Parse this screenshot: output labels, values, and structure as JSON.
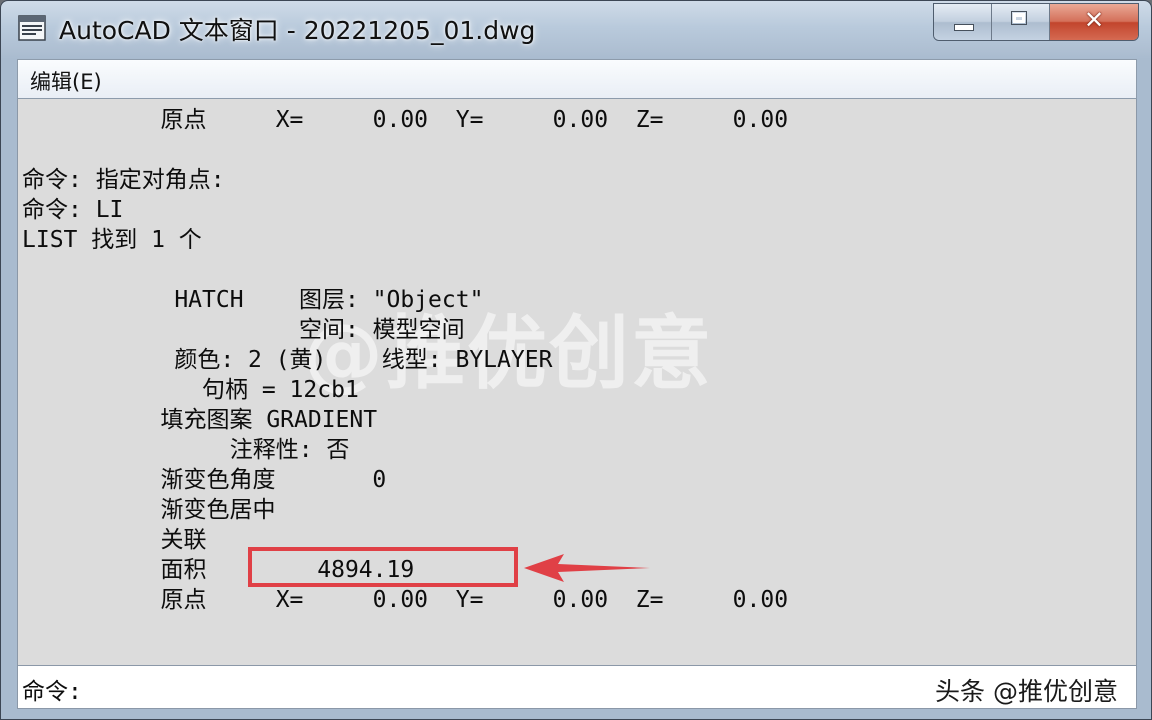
{
  "window": {
    "title": "AutoCAD 文本窗口 - 20221205_01.dwg",
    "icon": "autocad-text-window-icon",
    "controls": {
      "minimize": "minimize-icon",
      "maximize": "maximize-icon",
      "close": "close-icon"
    }
  },
  "menu": {
    "edit": "编辑(E)"
  },
  "text_window": {
    "lines": [
      "          原点     X=     0.00  Y=     0.00  Z=     0.00",
      "",
      "命令: 指定对角点:",
      "命令: LI",
      "LIST 找到 1 个",
      "",
      "           HATCH    图层: \"Object\"",
      "                    空间: 模型空间",
      "           颜色: 2 (黄)    线型: BYLAYER",
      "             句柄 = 12cb1",
      "          填充图案 GRADIENT",
      "               注释性: 否",
      "          渐变色角度       0",
      "          渐变色居中",
      "          关联",
      "          面积        4894.19",
      "          原点     X=     0.00  Y=     0.00  Z=     0.00"
    ],
    "watermark": "@推优创意",
    "highlight_color": "#e04046"
  },
  "command_line": {
    "prompt": "命令:",
    "value": ""
  },
  "credit": "头条 @推优创意"
}
